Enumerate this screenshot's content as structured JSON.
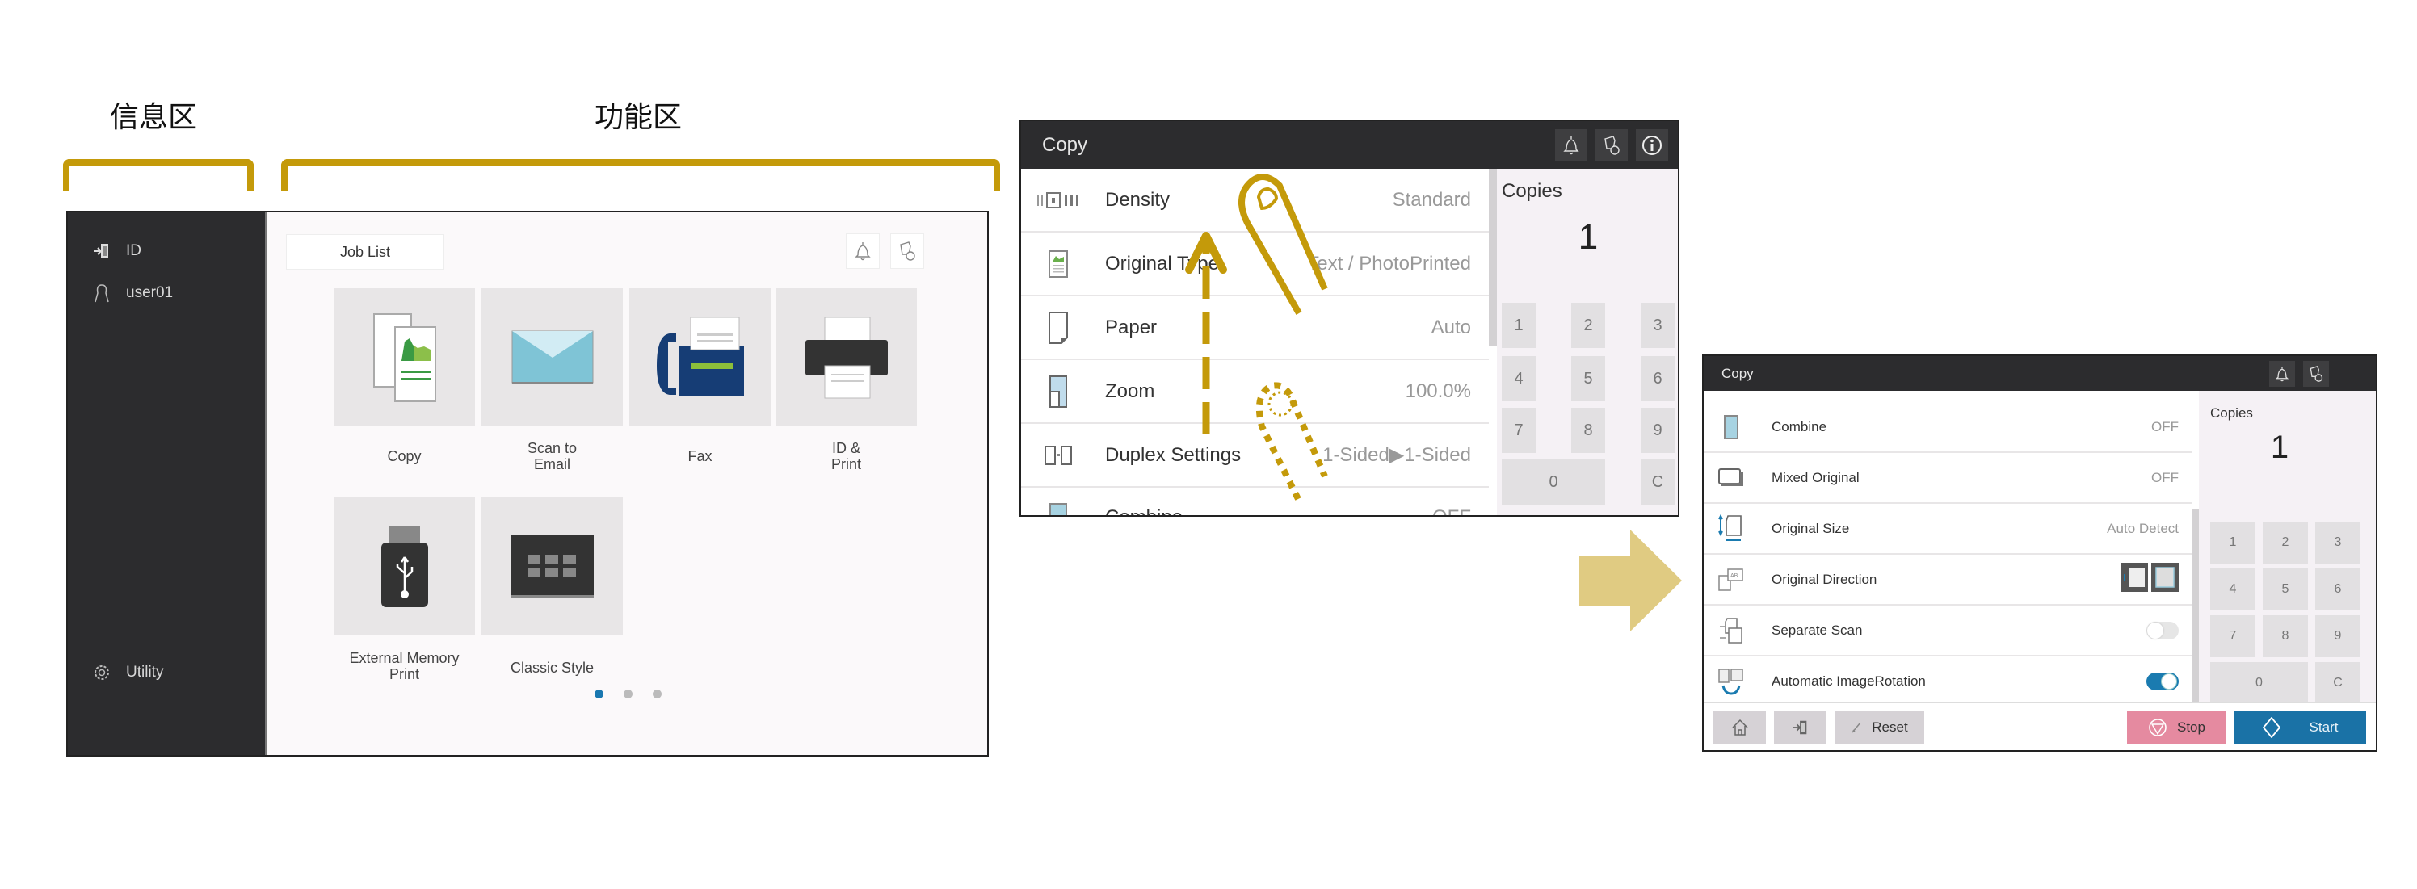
{
  "annotations": {
    "info_zone_label": "信息区",
    "function_zone_label": "功能区"
  },
  "home": {
    "sidebar": {
      "id_label": "ID",
      "user_label": "user01",
      "utility_label": "Utility"
    },
    "job_list_label": "Job List",
    "header_icons": [
      "bell-icon",
      "job-status-icon"
    ],
    "tiles": [
      {
        "label": "Copy",
        "icon": "copy-icon"
      },
      {
        "label": "Scan to\nEmail",
        "icon": "email-icon"
      },
      {
        "label": "Fax",
        "icon": "fax-icon"
      },
      {
        "label": "ID &\nPrint",
        "icon": "printer-icon"
      },
      {
        "label": "External Memory\nPrint",
        "icon": "usb-icon"
      },
      {
        "label": "Classic Style",
        "icon": "grid-icon"
      }
    ],
    "pages": {
      "count": 3,
      "current": 1
    }
  },
  "copy_screen_1": {
    "title": "Copy",
    "header_icons": [
      "bell-icon",
      "job-status-icon",
      "info-icon"
    ],
    "rows": [
      {
        "label": "Density",
        "value": "Standard",
        "icon": "density-icon"
      },
      {
        "label": "Original Type",
        "value": "Text / PhotoPrinted",
        "icon": "original-type-icon"
      },
      {
        "label": "Paper",
        "value": "Auto",
        "icon": "paper-icon"
      },
      {
        "label": "Zoom",
        "value": "100.0%",
        "icon": "zoom-icon"
      },
      {
        "label": "Duplex Settings",
        "value": "1-Sided▶1-Sided",
        "icon": "duplex-icon"
      },
      {
        "label": "Combine",
        "value": "OFF",
        "icon": "combine-icon"
      }
    ],
    "copies_label": "Copies",
    "copies_value": "1",
    "keypad": [
      "1",
      "2",
      "3",
      "4",
      "5",
      "6",
      "7",
      "8",
      "9",
      "0",
      "C"
    ]
  },
  "copy_screen_2": {
    "title": "Copy",
    "header_icons": [
      "bell-icon",
      "job-status-icon"
    ],
    "rows": [
      {
        "label": "Combine",
        "value": "OFF",
        "icon": "combine-icon"
      },
      {
        "label": "Mixed Original",
        "value": "OFF",
        "icon": "mixed-original-icon"
      },
      {
        "label": "Original Size",
        "value": "Auto Detect",
        "icon": "original-size-icon"
      },
      {
        "label": "Original Direction",
        "value": "",
        "icon": "original-direction-icon"
      },
      {
        "label": "Separate Scan",
        "value": "",
        "icon": "separate-scan-icon",
        "toggle": false
      },
      {
        "label": "Automatic ImageRotation",
        "value": "",
        "icon": "auto-rotation-icon",
        "toggle": true
      }
    ],
    "copies_label": "Copies",
    "copies_value": "1",
    "keypad": [
      "1",
      "2",
      "3",
      "4",
      "5",
      "6",
      "7",
      "8",
      "9",
      "0",
      "C"
    ],
    "footer": {
      "reset_label": "Reset",
      "stop_label": "Stop",
      "start_label": "Start"
    }
  },
  "colors": {
    "accent_gold": "#c49a0a",
    "arrow_fill": "#e0cb82",
    "start_blue": "#1a72a6",
    "stop_pink": "#e58aa0",
    "toggle_on": "#1a7bb0",
    "header_dark": "#2c2c2e"
  }
}
